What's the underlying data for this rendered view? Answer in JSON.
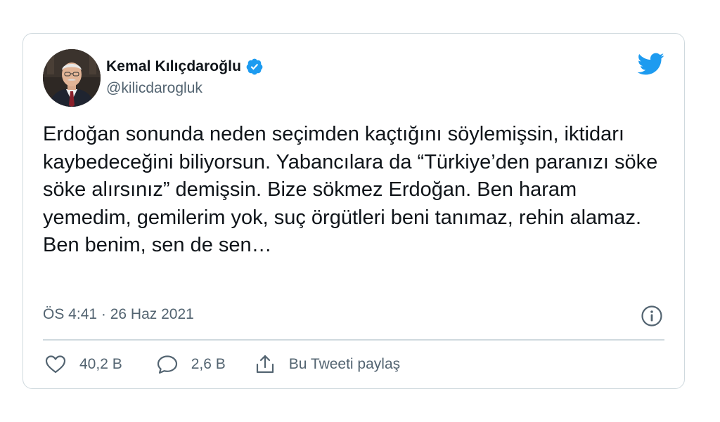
{
  "author": {
    "name": "Kemal Kılıçdaroğlu",
    "handle": "@kilicdarogluk",
    "avatar_icon": "profile-photo"
  },
  "tweet": {
    "text": "Erdoğan sonunda neden seçimden kaçtığını söylemişsin, iktidarı kaybedeceğini biliyorsun. Yabancılara da “Türkiye’den paranızı söke söke alırsınız” demişsin. Bize sökmez Erdoğan. Ben haram yemedim, gemilerim yok, suç örgütleri beni tanımaz, rehin alamaz. Ben benim, sen de sen…",
    "meta": "ÖS 4:41 · 26 Haz 2021"
  },
  "actions": {
    "likes": "40,2 B",
    "replies": "2,6 B",
    "share": "Bu Tweeti paylaş"
  },
  "icons": {
    "verified": "verified-badge-icon",
    "brand": "twitter-bird-icon",
    "info": "info-icon",
    "like": "heart-icon",
    "reply": "speech-bubble-icon",
    "share": "share-icon"
  },
  "colors": {
    "brand_blue": "#1d9bf0",
    "text_primary": "#0f1419",
    "text_secondary": "#536471",
    "border": "#cfd9de"
  }
}
